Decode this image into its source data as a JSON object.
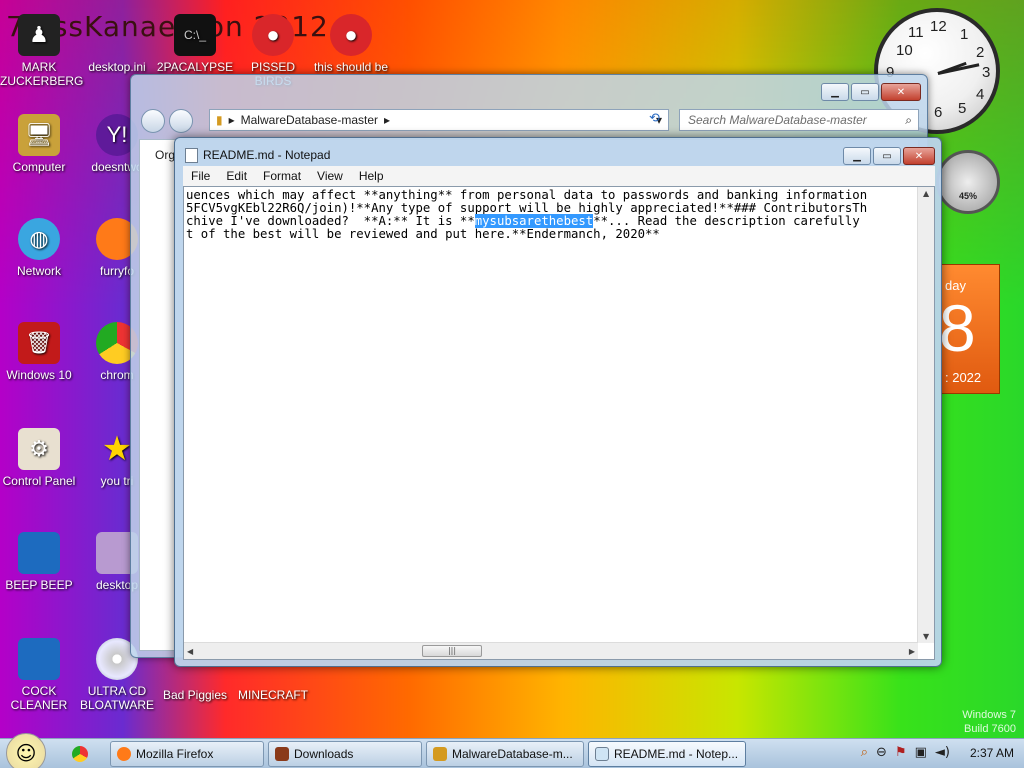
{
  "desktop": {
    "title_text": "7 ossKanae tion 2012",
    "icons_top": [
      "MARK\nZUCKERBERG",
      "desktop.ini",
      "2PACALYPSE",
      "PISSED BIRDS",
      "this should be"
    ],
    "icons_left": [
      "Computer",
      "Network",
      "Windows 10",
      "Control Panel",
      "BEEP BEEP",
      "COCK\nCLEANER"
    ],
    "icons_col2": [
      "doesntwo",
      "furryfo",
      "chrom",
      "you tri",
      "desktop",
      "ULTRA CD\nBLOATWARE"
    ],
    "icons_bottom": [
      "Bad Piggies",
      "MINECRAFT"
    ]
  },
  "explorer": {
    "path": "MalwareDatabase-master",
    "search_placeholder": "Search MalwareDatabase-master",
    "org_label": "Org"
  },
  "notepad": {
    "title": "README.md - Notepad",
    "menu": [
      "File",
      "Edit",
      "Format",
      "View",
      "Help"
    ],
    "line1": "uences which may affect **anything** from personal data to passwords and banking information",
    "line2": "5FCV5vgKEbl22R6Q/join)!**Any type of support will be highly appreciated!**### ContributorsTh",
    "line3_before": "chive I've downloaded?  **A:** It is **",
    "line3_selected": "mysubsarethebest",
    "line3_after": "**... Read the description carefully",
    "line4": "t of the best will be reviewed and put here.**Endermanch, 2020**"
  },
  "gadgets": {
    "clock_numbers": [
      "12",
      "1",
      "2",
      "3",
      "4",
      "5",
      "6",
      "7",
      "8",
      "9",
      "10",
      "11"
    ],
    "meter_value": "45%",
    "calendar_day": "day",
    "calendar_date": "8",
    "calendar_year": ": 2022"
  },
  "watermark": {
    "line1": "Windows 7",
    "line2": "Build 7600"
  },
  "taskbar": {
    "items": [
      "Mozilla Firefox",
      "Downloads",
      "MalwareDatabase-m...",
      "README.md - Notep..."
    ],
    "time": "2:37 AM"
  }
}
